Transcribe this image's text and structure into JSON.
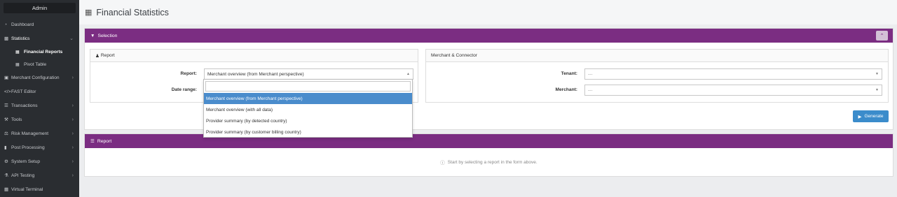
{
  "sidebar": {
    "user": "Admin",
    "items": [
      {
        "label": "Dashboard",
        "icon": "tachometer-icon"
      },
      {
        "label": "Statistics",
        "icon": "bar-chart-icon"
      },
      {
        "label": "Merchant Configuration",
        "icon": "briefcase-icon"
      },
      {
        "label": "FAST Editor",
        "icon": "code-icon"
      },
      {
        "label": "Transactions",
        "icon": "list-icon"
      },
      {
        "label": "Tools",
        "icon": "wrench-icon"
      },
      {
        "label": "Risk Management",
        "icon": "balance-icon"
      },
      {
        "label": "Post Processing",
        "icon": "file-icon"
      },
      {
        "label": "System Setup",
        "icon": "gear-icon"
      },
      {
        "label": "API Testing",
        "icon": "flask-icon"
      },
      {
        "label": "Virtual Terminal",
        "icon": "calculator-icon"
      }
    ],
    "sub_items": [
      {
        "label": "Financial Reports",
        "icon": "table-icon"
      },
      {
        "label": "Pivot Table",
        "icon": "table-icon"
      }
    ]
  },
  "page": {
    "title": "Financial Statistics"
  },
  "selection": {
    "header": "Selection",
    "report_box": {
      "title": "Report",
      "report_label": "Report:",
      "report_value": "Merchant overview (from Merchant perspective)",
      "date_label": "Date range:"
    },
    "merchant_box": {
      "title": "Merchant & Connector",
      "tenant_label": "Tenant:",
      "tenant_value": "---",
      "merchant_label": "Merchant:",
      "merchant_value": "---"
    },
    "generate_label": "Generate"
  },
  "dropdown": {
    "options": [
      "Merchant overview (from Merchant perspective)",
      "Merchant overview (with all data)",
      "Provider summary (by detected country)",
      "Provider summary (by customer billing country)"
    ]
  },
  "report": {
    "header": "Report",
    "empty_text": "Start by selecting a report in the form above."
  },
  "colors": {
    "accent": "#7b2d82",
    "primary": "#3b8ccb",
    "sidebar": "#2a2d31"
  }
}
